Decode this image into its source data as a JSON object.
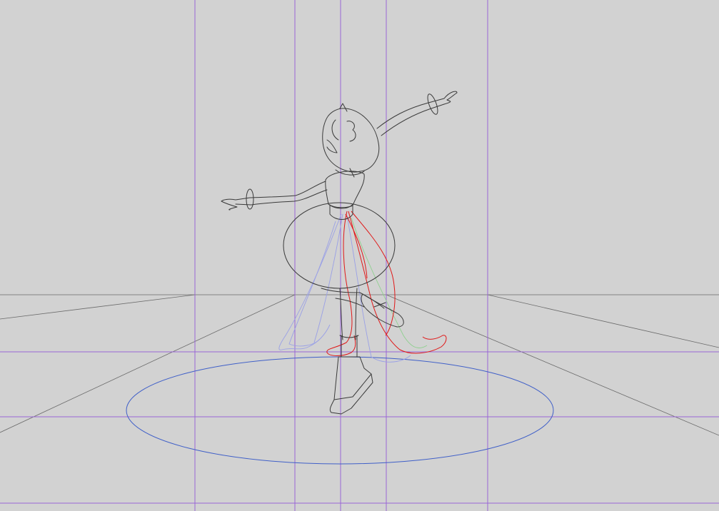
{
  "canvas": {
    "background": "#d2d2d2",
    "guide_color": "#9a66d6",
    "perspective_color": "#6a6a6a",
    "lineart_color": "#3a3a3a",
    "rough_red_color": "#e01818",
    "rough_blue_color": "#9aa0e6",
    "rough_green_color": "#8fd08f",
    "spotlight_color": "#3f5fc8"
  },
  "layers": [
    "perspective-guides",
    "layout-guides",
    "spotlight-ellipse",
    "dancer-lineart",
    "skirt-roughs"
  ]
}
